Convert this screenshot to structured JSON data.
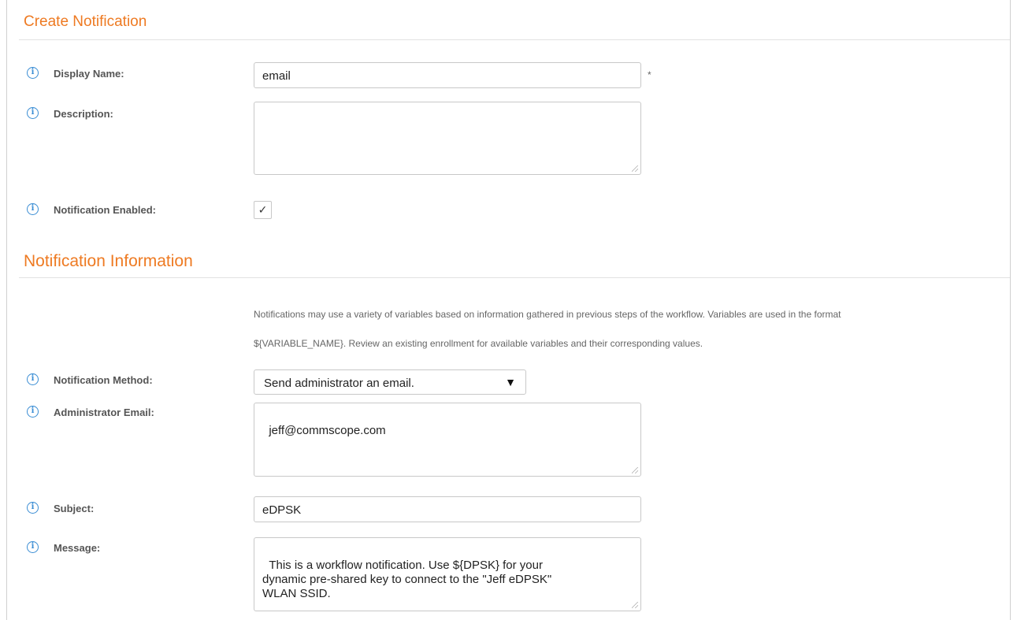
{
  "create_notification": {
    "title": "Create Notification",
    "display_name": {
      "label": "Display Name:",
      "value": "email",
      "required_mark": "*"
    },
    "description": {
      "label": "Description:",
      "value": ""
    },
    "notification_enabled": {
      "label": "Notification Enabled:",
      "checked": true,
      "check_glyph": "✓"
    }
  },
  "notification_information": {
    "title": "Notification Information",
    "help_line_1": "Notifications may use a variety of variables based on information gathered in previous steps of the workflow. Variables are used in the format",
    "help_line_2": "${VARIABLE_NAME}. Review an existing enrollment for available variables and their corresponding values.",
    "method": {
      "label": "Notification Method:",
      "value": "Send administrator an email.",
      "arrow": "▼"
    },
    "admin_email": {
      "label": "Administrator Email:",
      "value": "jeff@commscope.com"
    },
    "subject": {
      "label": "Subject:",
      "value": "eDPSK"
    },
    "message": {
      "label": "Message:",
      "value": "This is a workflow notification. Use ${DPSK} for your\ndynamic pre-shared key to connect to the \"Jeff eDPSK\"\nWLAN SSID."
    }
  },
  "info_icon_glyph": "i",
  "colors": {
    "section_title": "#ee7a22",
    "info_icon": "#3a8dd4",
    "border": "#c8c8c8"
  },
  "icons": {
    "info": "info-icon",
    "resize": "resize-handle-icon",
    "dropdown": "chevron-down-icon"
  }
}
